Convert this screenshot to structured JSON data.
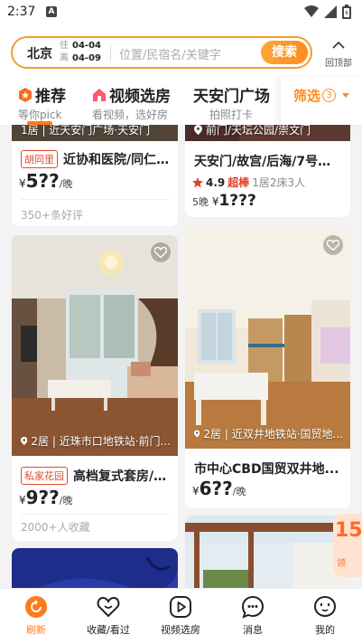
{
  "status": {
    "time": "2:37",
    "notif_letter": "A"
  },
  "search": {
    "city": "北京",
    "checkin_label": "住",
    "checkin": "04-04",
    "checkout_label": "离",
    "checkout": "04-09",
    "placeholder": "位置/民宿名/关键字",
    "button": "搜索",
    "back_to_top": "回顶部"
  },
  "tabs": [
    {
      "title": "推荐",
      "sub": "等你pick",
      "active": true
    },
    {
      "title": "视频选房",
      "sub": "看视频，选好房"
    },
    {
      "title": "天安门广场",
      "sub": "拍照打卡"
    }
  ],
  "filter": {
    "label": "筛选",
    "count": "3"
  },
  "cards": [
    {
      "loc": "1居 | 近天安门广场·天安门",
      "tag": "胡同里",
      "title": "近协和医院/同仁...",
      "price": "5??",
      "unit": "/晚",
      "meta": "350+条好评"
    },
    {
      "loc": "前门/天坛公园/崇文门",
      "title": "天安门/故宫/后海/7号线...",
      "score": "4.9",
      "badge": "超棒",
      "info": "1居2床3人",
      "nights": "5晚",
      "price": "1???"
    },
    {
      "loc": "2居 | 近珠市口地铁站·前门...",
      "tag": "私家花园",
      "title": "高档复式套房/7...",
      "price": "9??",
      "unit": "/晚",
      "meta": "2000+人收藏"
    },
    {
      "loc": "2居 | 近双井地铁站·国贸地...",
      "title": "市中心CBD国贸双井地...",
      "price": "6??",
      "unit": "/晚"
    }
  ],
  "float_badge": {
    "num": "15",
    "sub": "领"
  },
  "nav": [
    {
      "label": "刷新",
      "icon": "refresh-icon",
      "active": true
    },
    {
      "label": "收藏/看过",
      "icon": "heart-icon"
    },
    {
      "label": "视频选房",
      "icon": "video-icon"
    },
    {
      "label": "消息",
      "icon": "chat-icon"
    },
    {
      "label": "我的",
      "icon": "profile-icon"
    }
  ],
  "colors": {
    "accent": "#ff7a1a",
    "tag_red": "#e24b2b"
  }
}
